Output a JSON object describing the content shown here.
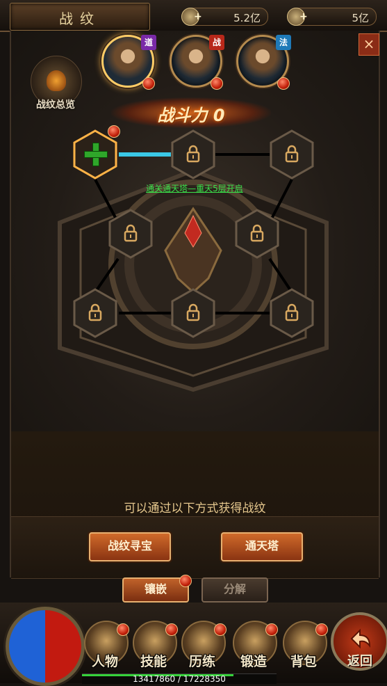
{
  "header": {
    "title": "战纹",
    "resources": [
      {
        "icon": "gold-coin-icon",
        "value": "5.2亿"
      },
      {
        "icon": "ingot-icon",
        "value": "5亿"
      }
    ],
    "close_label": "×"
  },
  "overview": {
    "label": "战纹总览"
  },
  "characters": [
    {
      "class_tag": "道",
      "tag_color": "#7a2aa8",
      "selected": true
    },
    {
      "class_tag": "战",
      "tag_color": "#b8281a",
      "selected": false
    },
    {
      "class_tag": "法",
      "tag_color": "#1f7ab8",
      "selected": false
    }
  ],
  "power": {
    "text": "战斗力 0"
  },
  "board": {
    "unlock_hint": "通关通天塔—重天5层开启",
    "slots": [
      {
        "state": "unlocked"
      },
      {
        "state": "locked"
      },
      {
        "state": "locked"
      },
      {
        "state": "locked"
      },
      {
        "state": "locked"
      },
      {
        "state": "locked"
      },
      {
        "state": "locked"
      },
      {
        "state": "locked"
      }
    ]
  },
  "info": {
    "text": "可以通过以下方式获得战纹",
    "sources": [
      {
        "label": "战纹寻宝"
      },
      {
        "label": "通天塔"
      }
    ]
  },
  "tabs": [
    {
      "label": "镶嵌",
      "active": true
    },
    {
      "label": "分解",
      "active": false
    }
  ],
  "nav": [
    {
      "label": "人物",
      "icon": "helmet-icon"
    },
    {
      "label": "技能",
      "icon": "skill-book-icon"
    },
    {
      "label": "历练",
      "icon": "winged-helm-icon"
    },
    {
      "label": "锻造",
      "icon": "anvil-icon"
    },
    {
      "label": "背包",
      "icon": "chest-icon"
    }
  ],
  "back_label": "返回",
  "experience": {
    "text": "13417860 / 17228350",
    "current": 13417860,
    "max": 17228350
  }
}
